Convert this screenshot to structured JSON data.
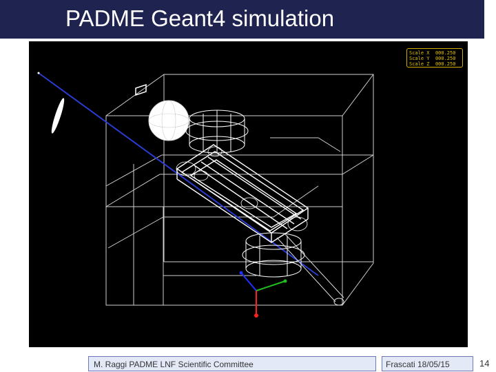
{
  "slide": {
    "title": "PADME Geant4 simulation",
    "page_number": "14"
  },
  "viewer": {
    "scale_readout": [
      {
        "label": "Scale X",
        "value": "000.250"
      },
      {
        "label": "Scale Y",
        "value": "000.250"
      },
      {
        "label": "Scale Z",
        "value": "000.250"
      }
    ]
  },
  "footer": {
    "left_text": "M. Raggi PADME LNF Scientific Committee",
    "right_text": "Frascati 18/05/15"
  },
  "colors": {
    "title_bar": "#1f2350",
    "beam_line": "#2a3ccf",
    "wireframe": "#ffffff",
    "axis_x": "#2030ff",
    "axis_y": "#20c020",
    "axis_z": "#ff2020",
    "scale_text": "#e3c200"
  }
}
